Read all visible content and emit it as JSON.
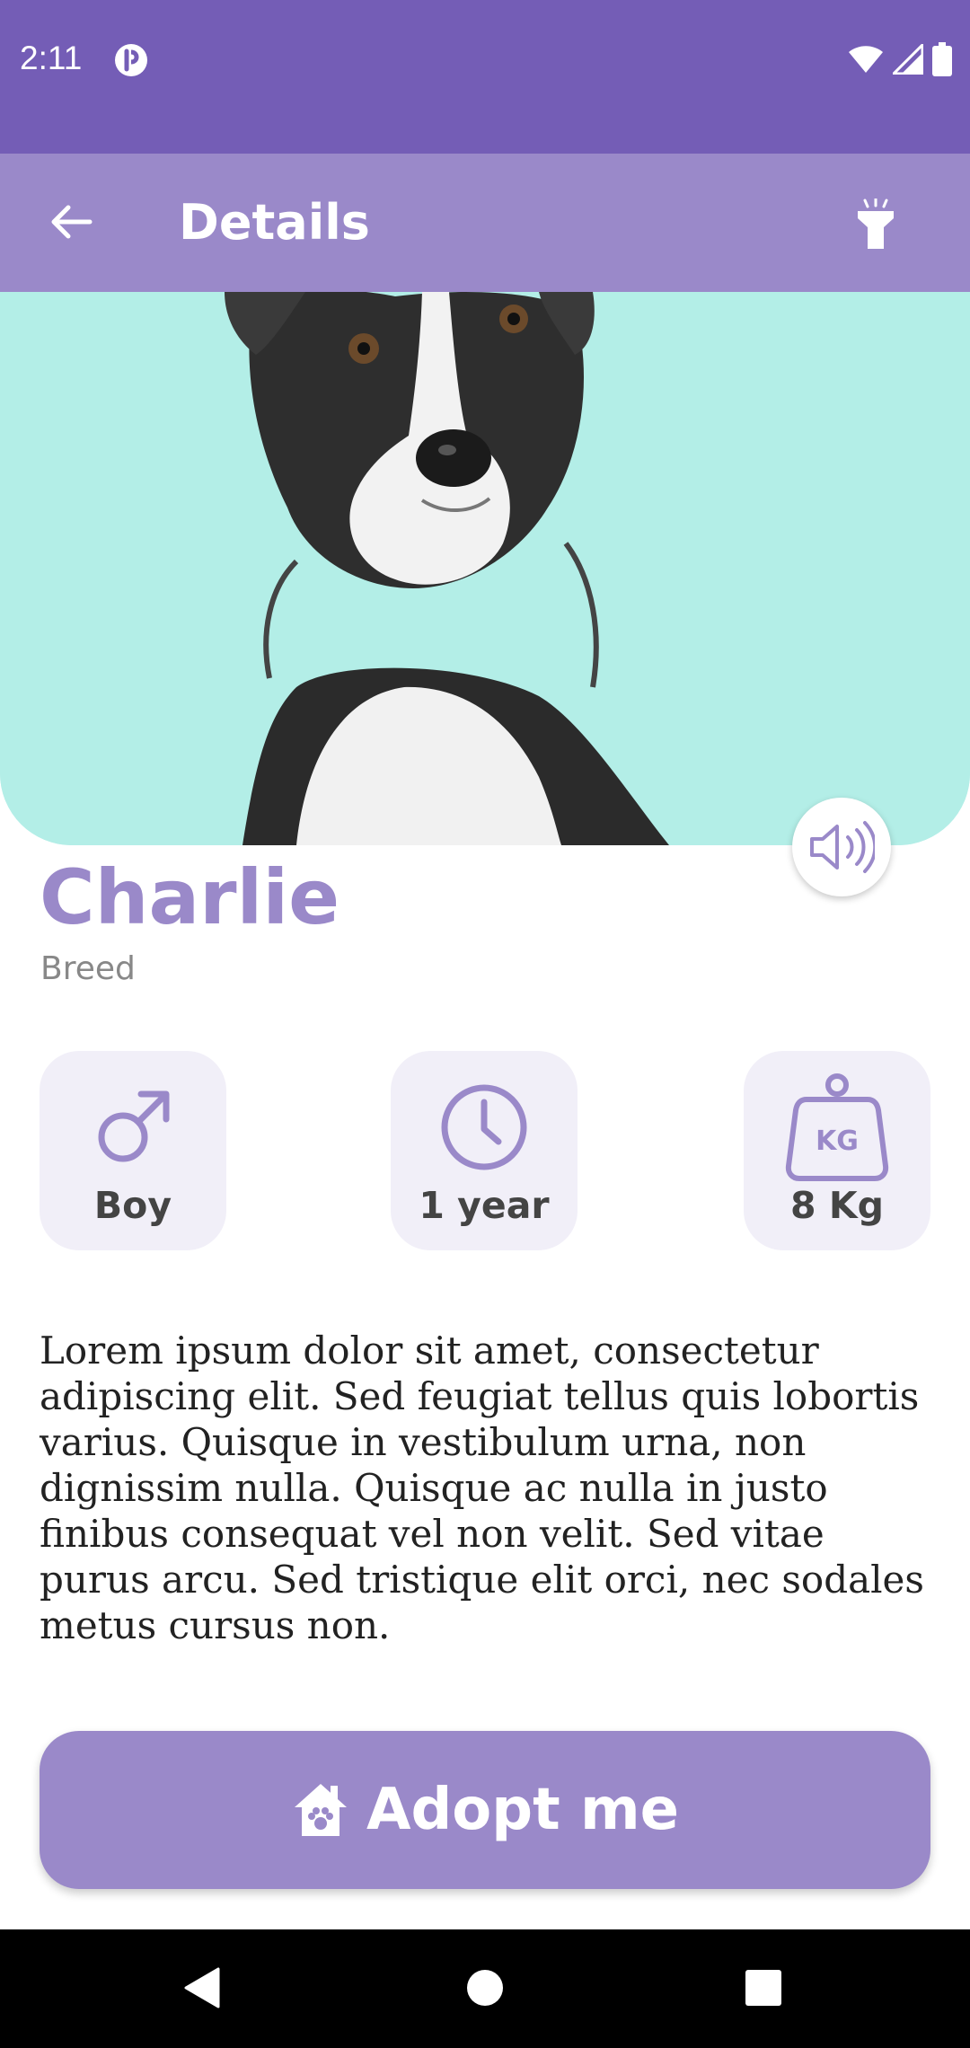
{
  "status_bar": {
    "time": "2:11",
    "background": "#745db6",
    "icons": [
      "app-notification-icon",
      "wifi-icon",
      "signal-icon",
      "battery-icon"
    ]
  },
  "app_bar": {
    "title": "Details",
    "background": "#9a89c9",
    "left_icon": "back-arrow-icon",
    "right_icon": "flashlight-icon"
  },
  "hero": {
    "image": "photo of a black and white dog on a mint background",
    "background": "#b3eee7",
    "sound_icon": "speaker-icon"
  },
  "pet": {
    "name": "Charlie",
    "breed": "Breed",
    "name_color": "#9a89c9"
  },
  "stats": [
    {
      "icon": "male-symbol-icon",
      "label": "Boy"
    },
    {
      "icon": "clock-icon",
      "label": "1 year"
    },
    {
      "icon": "weight-kg-icon",
      "label": "8 Kg"
    }
  ],
  "description": "Lorem ipsum dolor sit amet, consectetur adipiscing elit. Sed feugiat tellus quis lobortis varius. Quisque in vestibulum urna, non dignissim nulla. Quisque ac nulla in justo finibus consequat vel non velit. Sed vitae purus arcu. Sed tristique elit orci, nec sodales metus cursus non.",
  "adopt_button": {
    "label": "Adopt me",
    "icon": "house-paw-icon",
    "background": "#9a89c9"
  },
  "nav_bar": {
    "items": [
      "back-triangle-icon",
      "home-circle-icon",
      "recents-square-icon"
    ]
  }
}
